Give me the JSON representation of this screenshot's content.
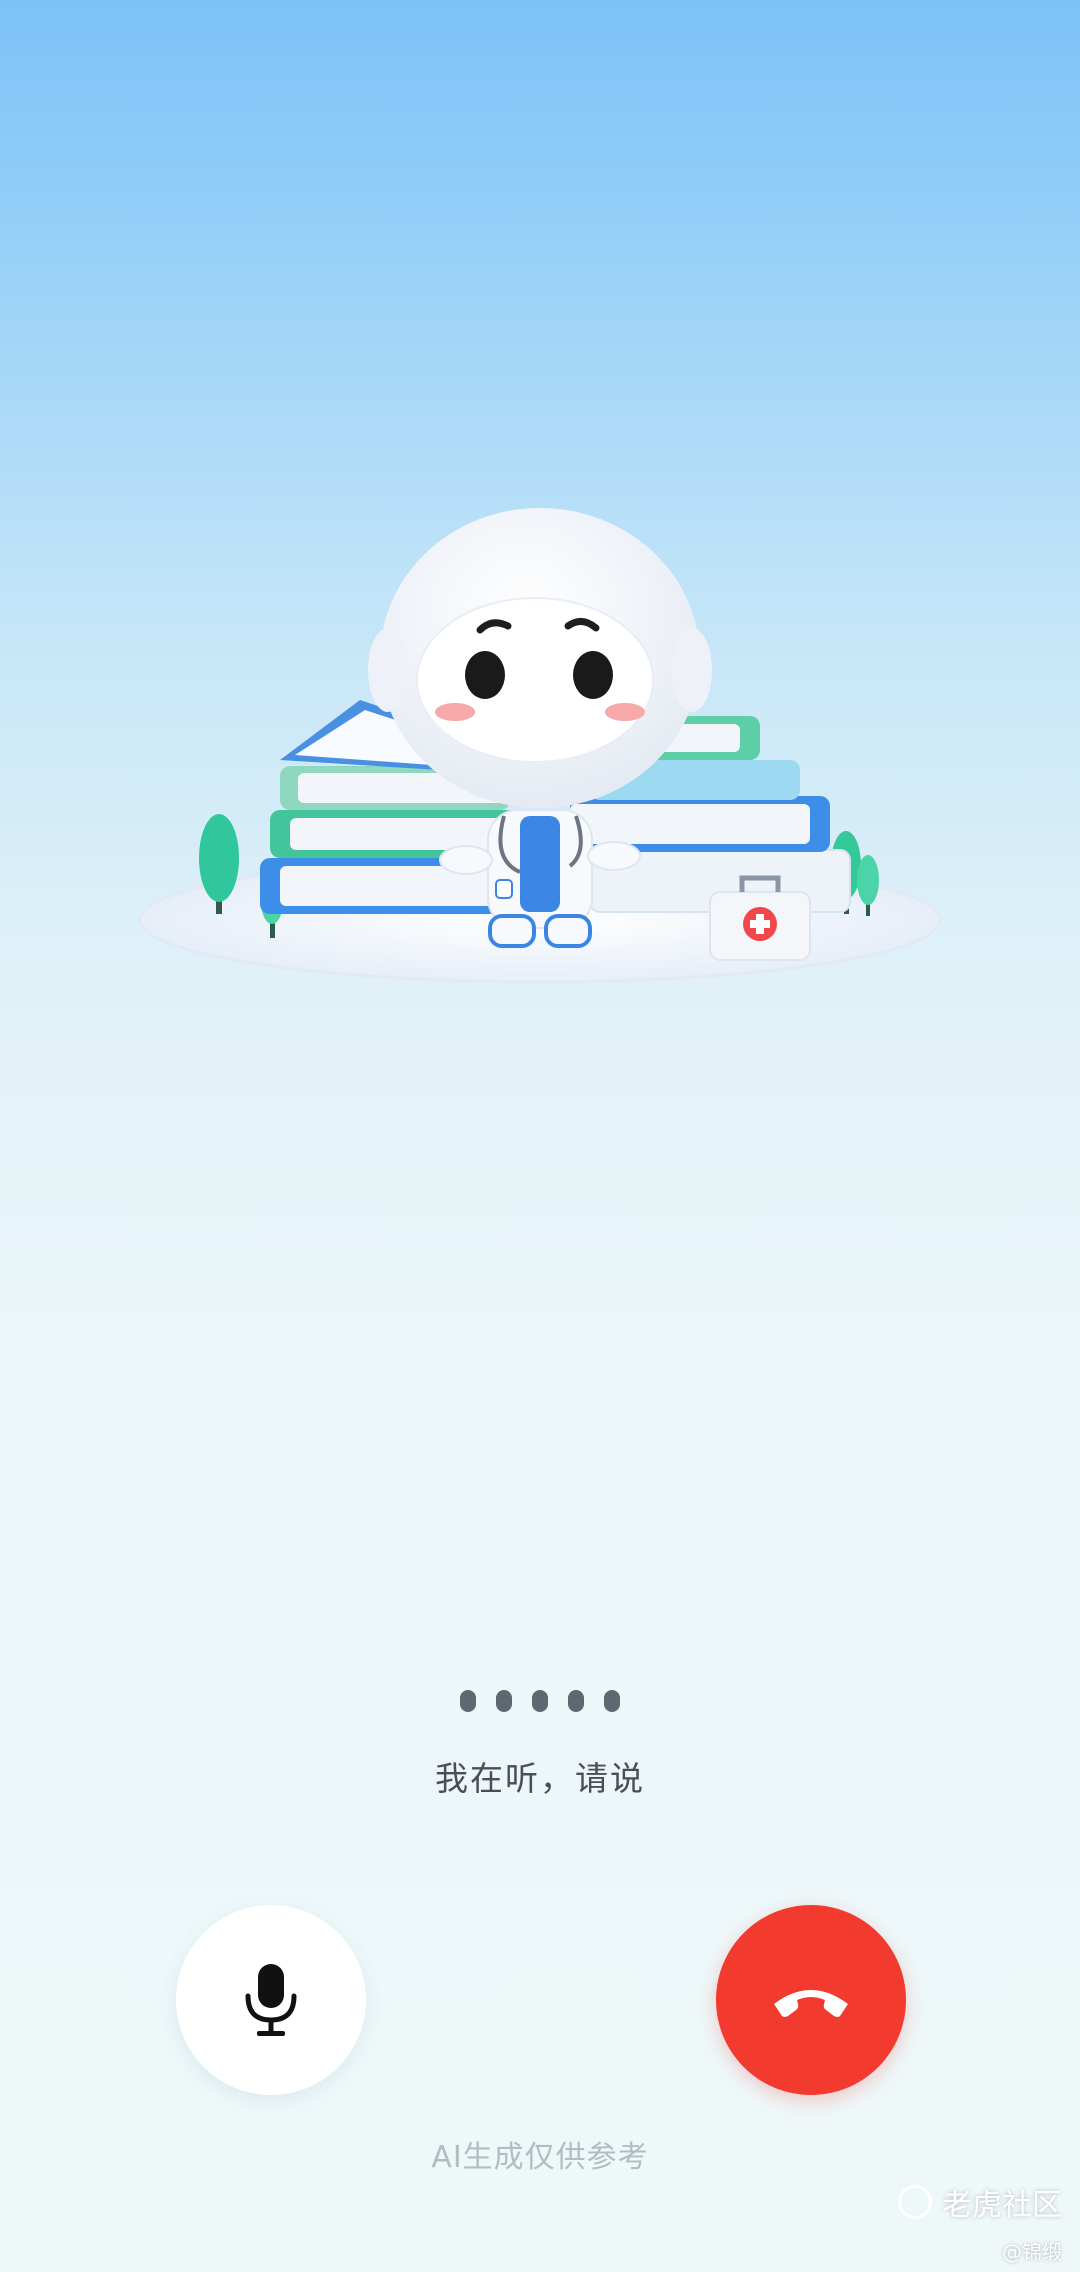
{
  "status": {
    "listening_text": "我在听，请说",
    "indicator_dots": 5
  },
  "controls": {
    "mic_icon": "microphone-icon",
    "hangup_icon": "phone-hangup-icon"
  },
  "footer": {
    "disclaimer": "AI生成仅供参考"
  },
  "watermark": {
    "brand": "老虎社区",
    "handle": "@锦缎"
  },
  "colors": {
    "hangup": "#f33a2f",
    "mic_button": "#ffffff",
    "dots": "#5f6770"
  }
}
